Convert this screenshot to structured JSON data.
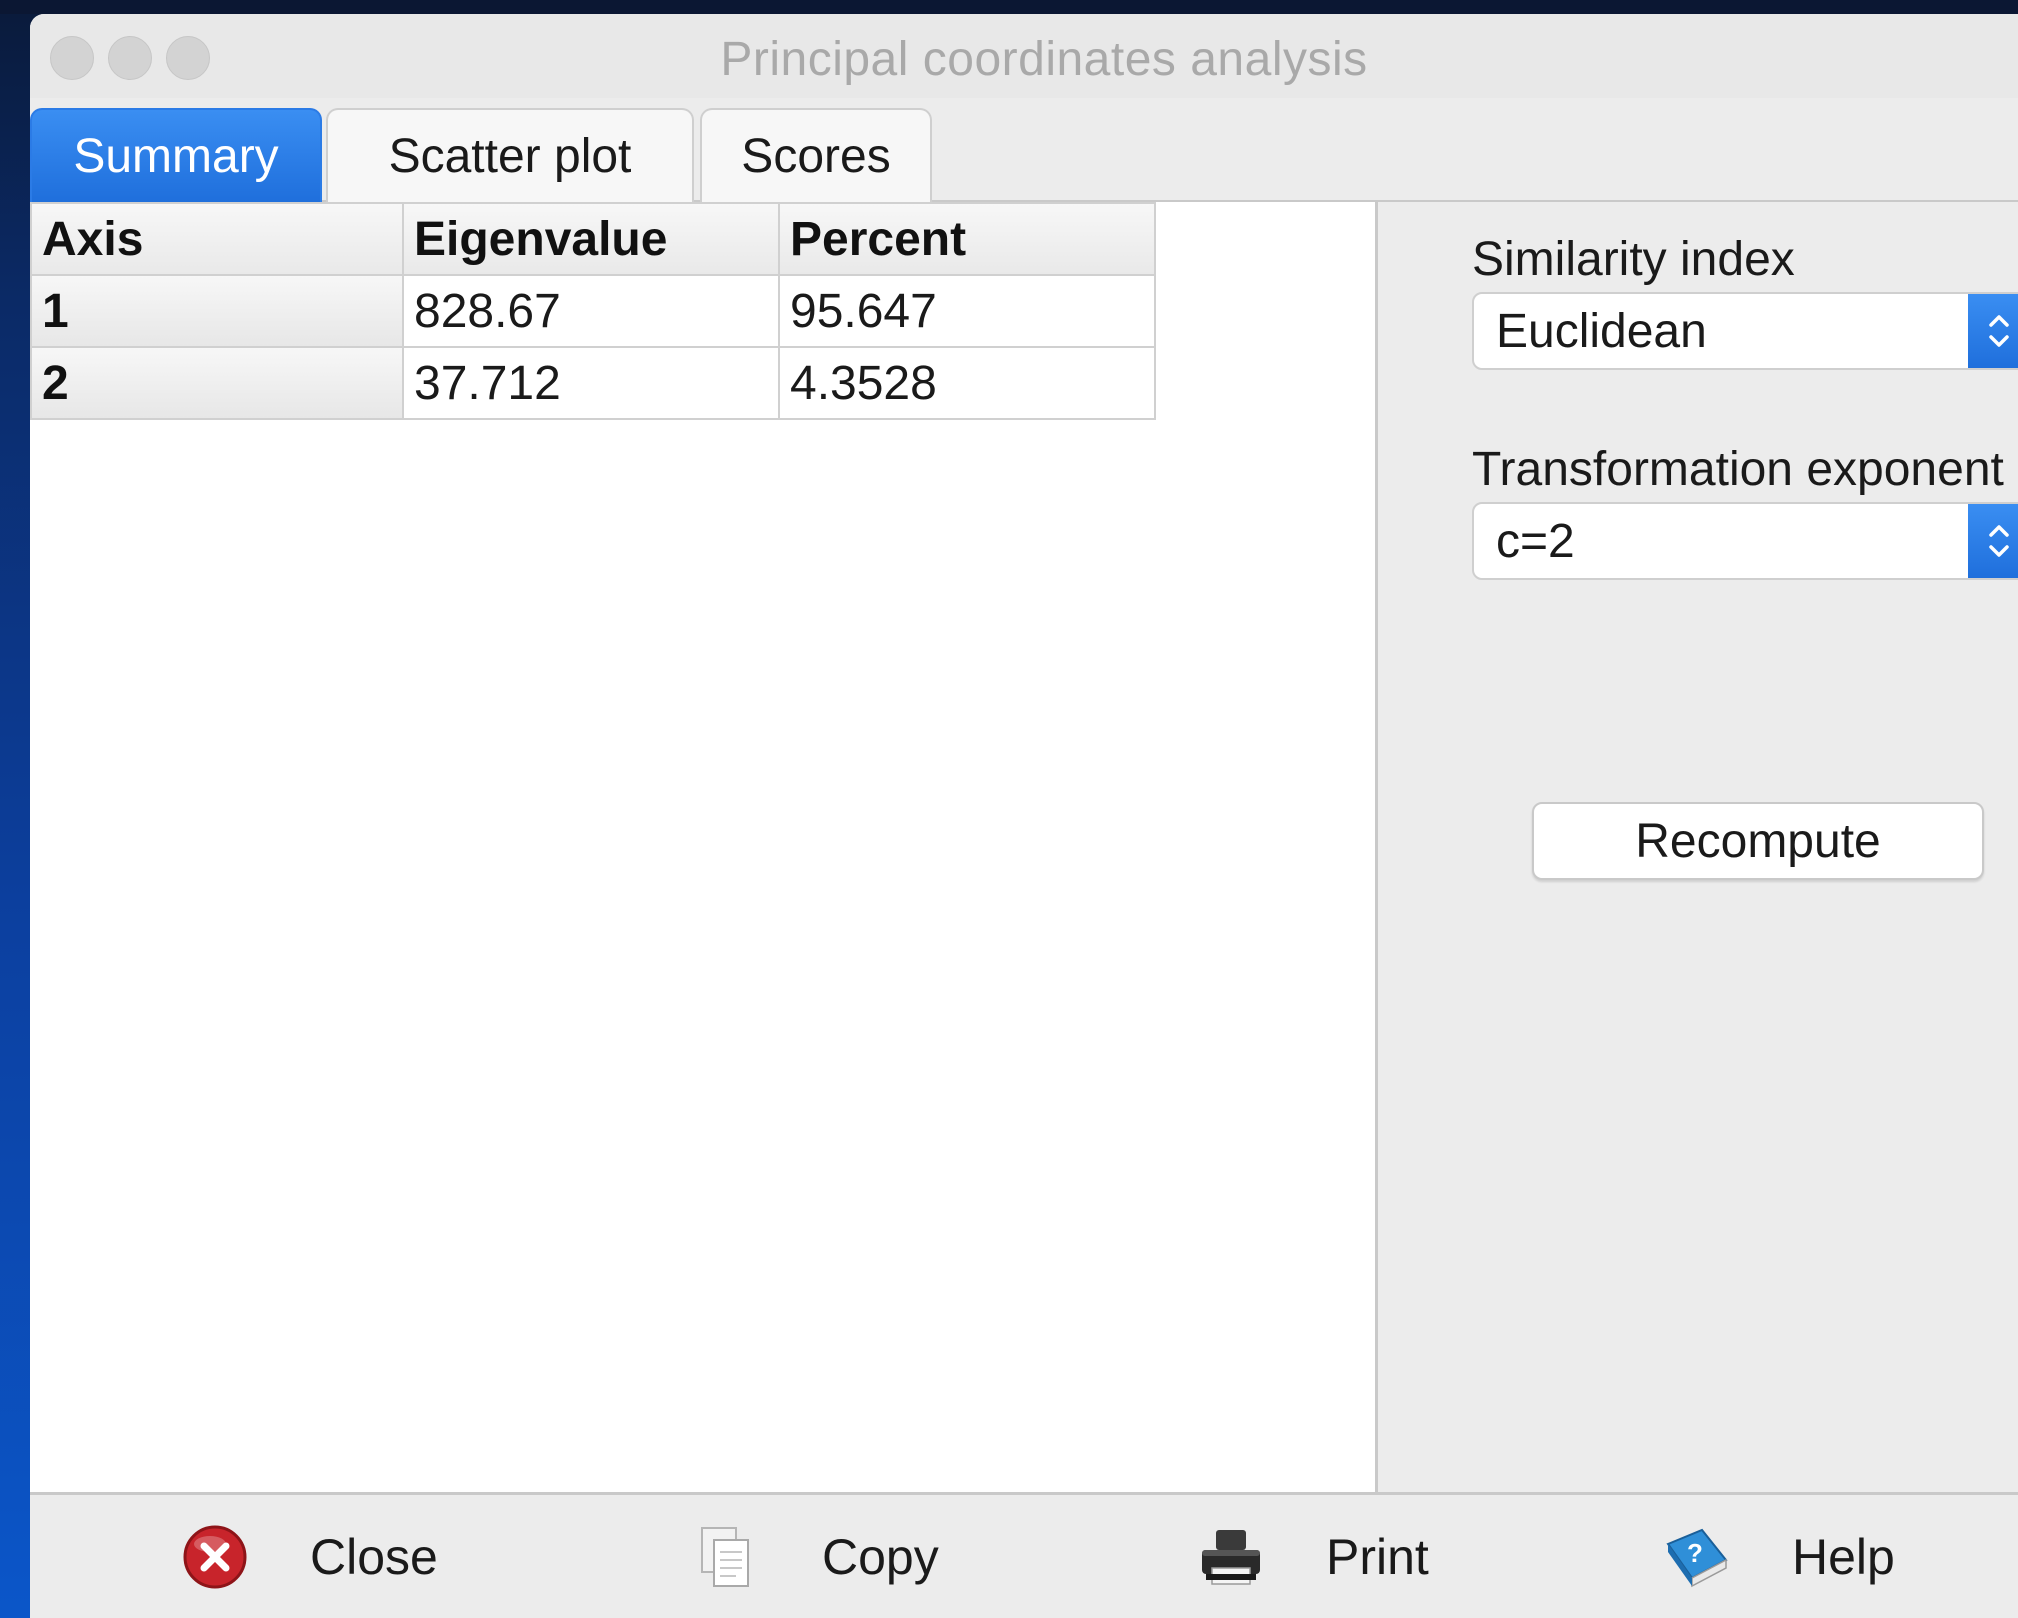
{
  "window": {
    "title": "Principal coordinates analysis"
  },
  "tabs": [
    {
      "label": "Summary",
      "active": true
    },
    {
      "label": "Scatter plot",
      "active": false
    },
    {
      "label": "Scores",
      "active": false
    }
  ],
  "summary_table": {
    "headers": [
      "Axis",
      "Eigenvalue",
      "Percent"
    ],
    "rows": [
      [
        "1",
        "828.67",
        "95.647"
      ],
      [
        "2",
        "37.712",
        "4.3528"
      ]
    ]
  },
  "options": {
    "similarity_label": "Similarity index",
    "similarity_value": "Euclidean",
    "exponent_label": "Transformation exponent",
    "exponent_value": "c=2",
    "recompute_label": "Recompute"
  },
  "toolbar": {
    "close_label": "Close",
    "copy_label": "Copy",
    "print_label": "Print",
    "help_label": "Help"
  },
  "colors": {
    "accent": "#2b7be6",
    "close_icon": "#c8242b",
    "help_icon": "#2f8fd8"
  }
}
